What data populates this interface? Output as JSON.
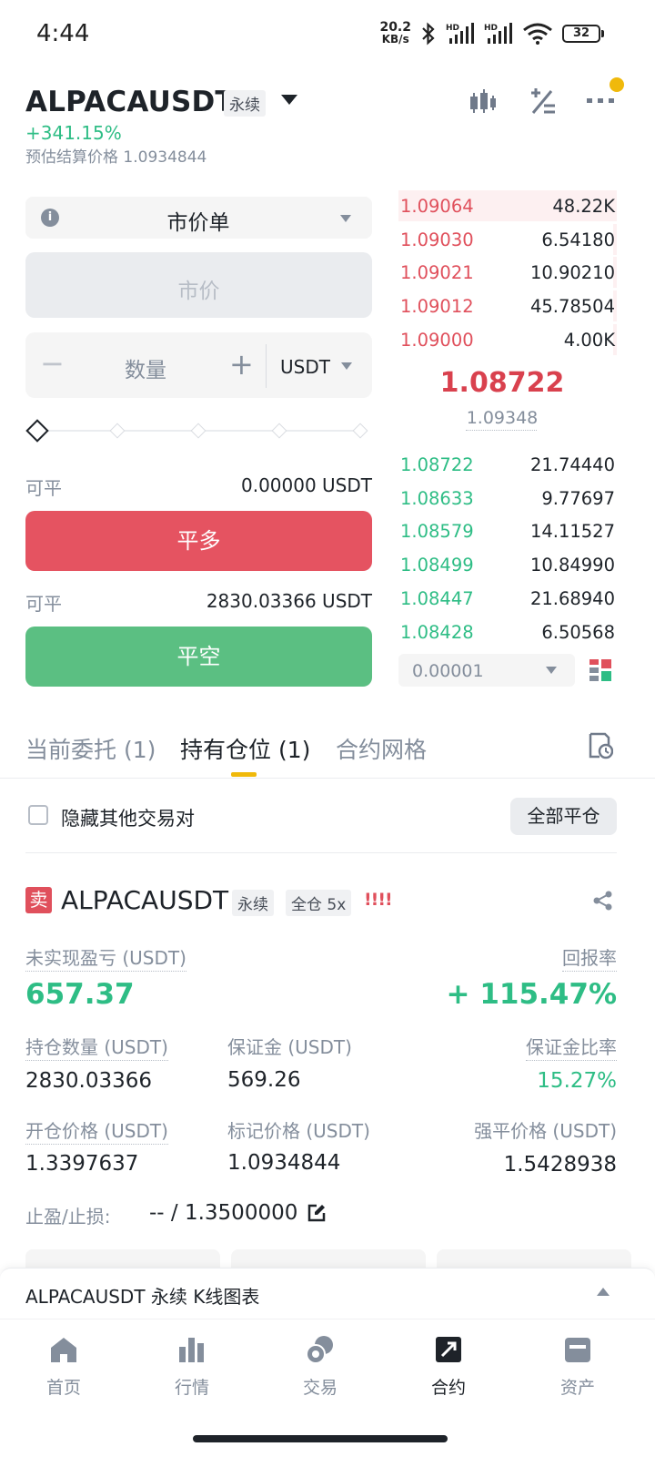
{
  "status_bar": {
    "time": "4:44",
    "net_speed": "20.2",
    "net_unit": "KB/s",
    "battery": "32",
    "icons": [
      "bluetooth-icon",
      "signal-hd-icon",
      "signal-hd-icon",
      "wifi-icon",
      "battery-icon"
    ]
  },
  "header": {
    "pair": "ALPACAUSDT",
    "type_tag": "永续",
    "change": "+341.15%",
    "est_label": "预估结算价格",
    "est_price": "1.0934844",
    "icons": [
      "candlestick-icon",
      "calculator-icon",
      "more-icon"
    ],
    "notification_color": "#f0b90b"
  },
  "order_form": {
    "order_type": "市价单",
    "price_placeholder": "市价",
    "qty_placeholder": "数量",
    "qty_minus": "−",
    "qty_plus": "+",
    "qty_unit": "USDT",
    "slider_percent": 0,
    "close_long": {
      "avail_label": "可平",
      "avail_value": "0.00000 USDT",
      "button": "平多"
    },
    "close_short": {
      "avail_label": "可平",
      "avail_value": "2830.03366 USDT",
      "button": "平空"
    }
  },
  "order_book": {
    "asks": [
      {
        "price": "1.09064",
        "qty": "48.22K"
      },
      {
        "price": "1.09030",
        "qty": "6.54180"
      },
      {
        "price": "1.09021",
        "qty": "10.90210"
      },
      {
        "price": "1.09012",
        "qty": "45.78504"
      },
      {
        "price": "1.09000",
        "qty": "4.00K"
      }
    ],
    "last_price": "1.08722",
    "mark_price": "1.09348",
    "bids": [
      {
        "price": "1.08722",
        "qty": "21.74440"
      },
      {
        "price": "1.08633",
        "qty": "9.77697"
      },
      {
        "price": "1.08579",
        "qty": "14.11527"
      },
      {
        "price": "1.08499",
        "qty": "10.84990"
      },
      {
        "price": "1.08447",
        "qty": "21.68940"
      },
      {
        "price": "1.08428",
        "qty": "6.50568"
      }
    ],
    "precision": "0.00001",
    "colors": {
      "ask": "#e0505c",
      "bid": "#2ebd85"
    }
  },
  "tabs": [
    {
      "label": "当前委托 (1)",
      "active": false
    },
    {
      "label": "持有仓位 (1)",
      "active": true
    },
    {
      "label": "合约网格",
      "active": false
    }
  ],
  "filter": {
    "hide_label": "隐藏其他交易对",
    "close_all": "全部平仓"
  },
  "position": {
    "side": "卖",
    "pair": "ALPACAUSDT",
    "tag_type": "永续",
    "tag_margin": "全仓 5x",
    "risk_bars": "!!!!",
    "pnl_label": "未实现盈亏 (USDT)",
    "pnl_value": "657.37",
    "roe_label": "回报率",
    "roe_value": "+ 115.47%",
    "size_label": "持仓数量 (USDT)",
    "size_value": "2830.03366",
    "margin_label": "保证金 (USDT)",
    "margin_value": "569.26",
    "margin_ratio_label": "保证金比率",
    "margin_ratio_value": "15.27%",
    "entry_label": "开仓价格 (USDT)",
    "entry_value": "1.3397637",
    "mark_label": "标记价格 (USDT)",
    "mark_value": "1.0934844",
    "liq_label": "强平价格 (USDT)",
    "liq_value": "1.5428938",
    "tpsl_label": "止盈/止损:",
    "tpsl_value": "-- / 1.3500000"
  },
  "kline_bar": {
    "label": "ALPACAUSDT 永续 K线图表"
  },
  "bottom_nav": [
    {
      "label": "首页",
      "icon": "home-icon",
      "active": false
    },
    {
      "label": "行情",
      "icon": "markets-icon",
      "active": false
    },
    {
      "label": "交易",
      "icon": "trade-icon",
      "active": false
    },
    {
      "label": "合约",
      "icon": "futures-icon",
      "active": true
    },
    {
      "label": "资产",
      "icon": "wallet-icon",
      "active": false
    }
  ]
}
